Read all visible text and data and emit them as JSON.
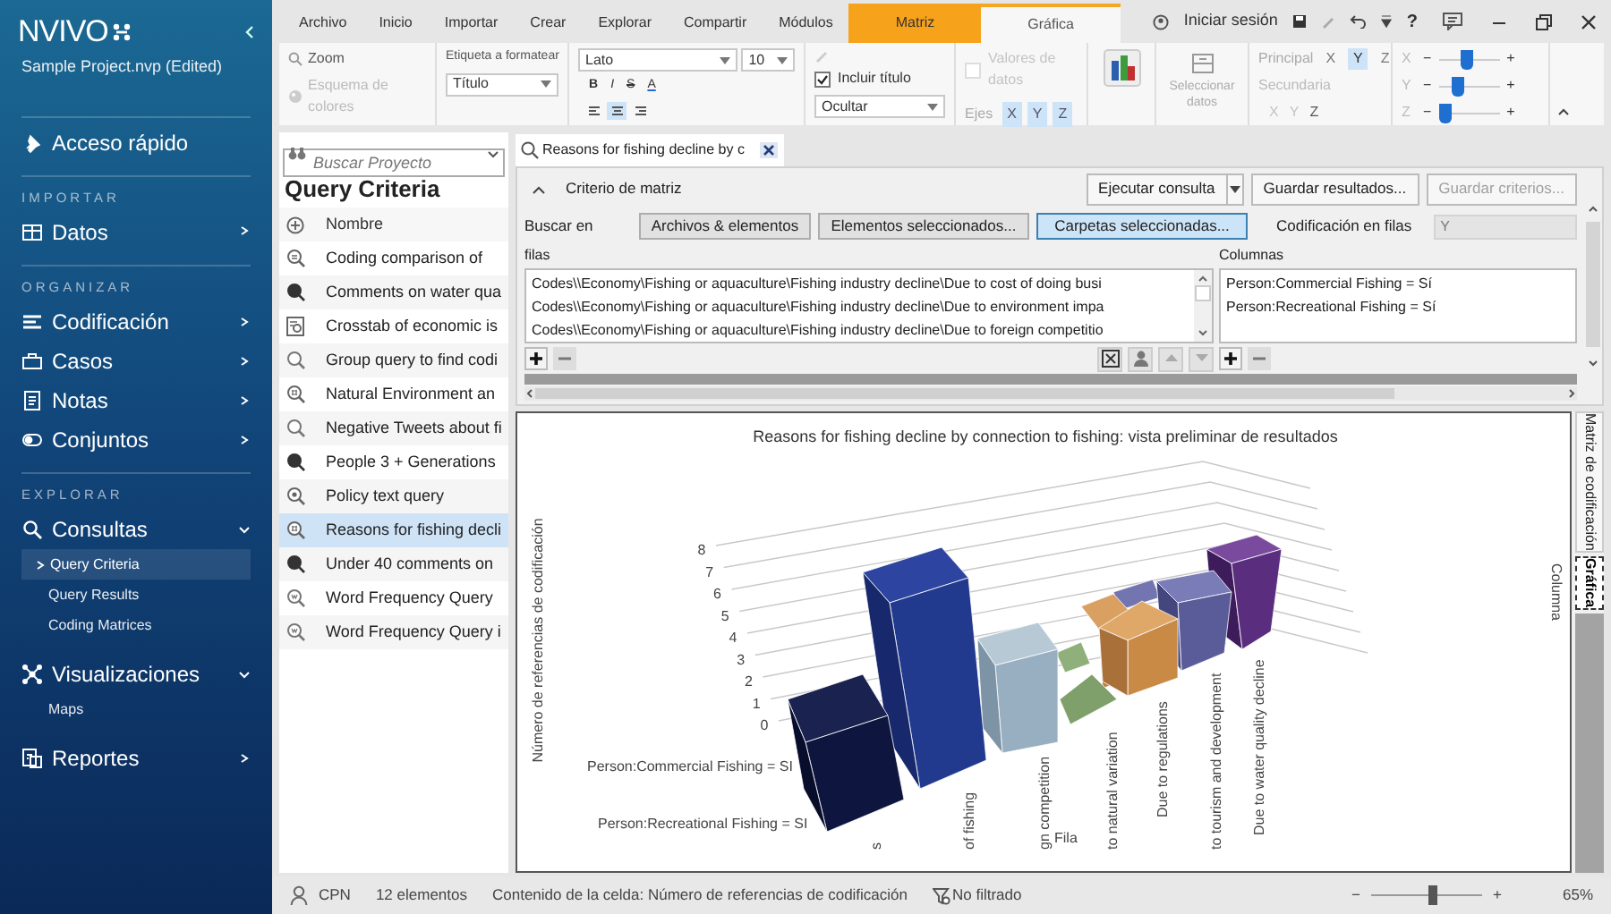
{
  "app": {
    "logo": "NVIVO",
    "project": "Sample Project.nvp (Edited)"
  },
  "sidebar": {
    "sections": [
      {
        "items": [
          {
            "label": "Acceso rápido"
          }
        ]
      },
      {
        "heading": "IMPORTAR",
        "items": [
          {
            "label": "Datos",
            "expanded": false
          }
        ]
      },
      {
        "heading": "ORGANIZAR",
        "items": [
          {
            "label": "Codificación",
            "expanded": false
          },
          {
            "label": "Casos",
            "expanded": false
          },
          {
            "label": "Notas",
            "expanded": false
          },
          {
            "label": "Conjuntos",
            "expanded": false
          }
        ]
      },
      {
        "heading": "EXPLORAR",
        "items": [
          {
            "label": "Consultas",
            "expanded": true,
            "children": [
              {
                "label": "Query Criteria",
                "selected": true
              },
              {
                "label": "Query Results",
                "selected": false
              },
              {
                "label": "Coding Matrices",
                "selected": false
              }
            ]
          },
          {
            "label": "Visualizaciones",
            "expanded": true,
            "children": [
              {
                "label": "Maps",
                "selected": false
              }
            ]
          },
          {
            "label": "Reportes",
            "expanded": false
          }
        ]
      }
    ]
  },
  "ribbon_tabs": [
    {
      "label": "Archivo",
      "kind": "plain",
      "selected": false
    },
    {
      "label": "Inicio",
      "kind": "plain",
      "selected": false
    },
    {
      "label": "Importar",
      "kind": "plain",
      "selected": false
    },
    {
      "label": "Crear",
      "kind": "plain",
      "selected": false
    },
    {
      "label": "Explorar",
      "kind": "plain",
      "selected": false
    },
    {
      "label": "Compartir",
      "kind": "plain",
      "selected": false
    },
    {
      "label": "Módulos",
      "kind": "plain",
      "selected": false
    },
    {
      "label": "Matriz",
      "kind": "context",
      "selected": false
    },
    {
      "label": "Gráfica",
      "kind": "context",
      "selected": true
    }
  ],
  "title_bar": {
    "sign_in": "Iniciar sesión",
    "help": "?"
  },
  "ribbon": {
    "zoom": "Zoom",
    "color_scheme": {
      "label": "Esquema de colores",
      "disabled": true
    },
    "label_format": {
      "label": "Etiqueta a formatear",
      "value": "Título"
    },
    "font": {
      "family": "Lato",
      "size": "10"
    },
    "format_buttons": [
      {
        "label": "B"
      },
      {
        "label": "I"
      },
      {
        "label": "S"
      },
      {
        "label": "A"
      }
    ],
    "align": [
      {
        "selected": false
      },
      {
        "selected": true
      },
      {
        "selected": false
      }
    ],
    "include_title": {
      "label": "Incluir título",
      "checked": true
    },
    "legend": {
      "value": "Ocultar"
    },
    "data_values": {
      "label": "Valores de datos",
      "checked": false,
      "disabled": true
    },
    "axes": {
      "label": "Ejes",
      "items": [
        {
          "label": "X",
          "selected": true
        },
        {
          "label": "Y",
          "selected": true
        },
        {
          "label": "Z",
          "selected": true
        }
      ]
    },
    "select_data": {
      "label": "Seleccionar datos",
      "disabled": true
    },
    "primary": {
      "label": "Principal",
      "items": [
        {
          "label": "X",
          "selected": false
        },
        {
          "label": "Y",
          "selected": true
        },
        {
          "label": "Z",
          "selected": false
        }
      ]
    },
    "secondary": {
      "label": "Secundaria",
      "items": [
        {
          "label": "X",
          "disabled": true
        },
        {
          "label": "Y",
          "disabled": true
        },
        {
          "label": "Z",
          "disabled": false
        }
      ]
    },
    "rotation": [
      {
        "axis": "X",
        "minus": "−",
        "plus": "+",
        "level": 0.45
      },
      {
        "axis": "Y",
        "minus": "−",
        "plus": "+",
        "level": 0.3
      },
      {
        "axis": "Z",
        "minus": "−",
        "plus": "+",
        "level": 0.1
      }
    ]
  },
  "project_pane": {
    "search": {
      "placeholder": "Buscar Proyecto"
    },
    "title": "Query Criteria",
    "column": "Nombre",
    "items": [
      {
        "label": "Coding comparison of",
        "kind": "coding",
        "selected": false
      },
      {
        "label": "Comments on water qua",
        "kind": "text",
        "selected": false
      },
      {
        "label": "Crosstab of economic is",
        "kind": "crosstab",
        "selected": false
      },
      {
        "label": "Group query to find codi",
        "kind": "find",
        "selected": false
      },
      {
        "label": "Natural Environment an",
        "kind": "matrix",
        "selected": false
      },
      {
        "label": "Negative Tweets about fi",
        "kind": "find",
        "selected": false
      },
      {
        "label": "People 3 + Generations",
        "kind": "text",
        "selected": false
      },
      {
        "label": "Policy text query",
        "kind": "compound",
        "selected": false
      },
      {
        "label": "Reasons for fishing decli",
        "kind": "matrix",
        "selected": true
      },
      {
        "label": "Under 40 comments on",
        "kind": "text",
        "selected": false
      },
      {
        "label": "Word Frequency Query",
        "kind": "word",
        "selected": false
      },
      {
        "label": "Word Frequency Query i",
        "kind": "word",
        "selected": false
      }
    ]
  },
  "document_tab": {
    "label": "Reasons for fishing decline by c"
  },
  "criteria": {
    "header": "Criterio de matriz",
    "expanded": true,
    "run": "Ejecutar consulta",
    "save_results": "Guardar resultados...",
    "save_criteria": {
      "label": "Guardar criterios...",
      "disabled": true
    },
    "search_in_label": "Buscar en",
    "scopes": [
      {
        "label": "Archivos & elementos",
        "selected": false
      },
      {
        "label": "Elementos seleccionados...",
        "selected": false
      },
      {
        "label": "Carpetas seleccionadas...",
        "selected": true
      }
    ],
    "coding_in_rows": {
      "label": "Codificación en filas",
      "value": "Y",
      "disabled": true
    },
    "rows_label": "filas",
    "rows": [
      "Codes\\\\Economy\\Fishing or aquaculture\\Fishing industry decline\\Due to cost of doing busi",
      "Codes\\\\Economy\\Fishing or aquaculture\\Fishing industry decline\\Due to environment impa",
      "Codes\\\\Economy\\Fishing or aquaculture\\Fishing industry decline\\Due to foreign competitio"
    ],
    "columns_label": "Columnas",
    "columns": [
      "Person:Commercial Fishing = Sí",
      "Person:Recreational Fishing = Sí"
    ]
  },
  "chart": {
    "title": "Reasons for fishing decline by connection to fishing: vista preliminar de resultados",
    "ylabel": "Número de referencias de codificación",
    "tick_labels": [
      "0",
      "1",
      "2",
      "3",
      "4",
      "5",
      "6",
      "7",
      "8"
    ],
    "series_labels": [
      "Person:Commercial Fishing = SI",
      "Person:Recreational Fishing = SI"
    ],
    "categories": [
      "s",
      "of fishing",
      "gn competition",
      "to natural variation",
      "Due to regulations",
      "to tourism and development",
      "Due to water quality decline"
    ],
    "xlabel": "Fila",
    "zlabel": "Columna"
  },
  "side_tabs": [
    {
      "label": "Matriz de codificación",
      "selected": false
    },
    {
      "label": "Gráfica",
      "selected": true
    }
  ],
  "status_bar": {
    "user": "CPN",
    "count": "12 elementos",
    "cell_content": "Contenido de la celda: Número de referencias de codificación",
    "filter": "No filtrado",
    "zoom": {
      "minus": "−",
      "plus": "+",
      "level": 0.55,
      "reading": "65%"
    }
  }
}
